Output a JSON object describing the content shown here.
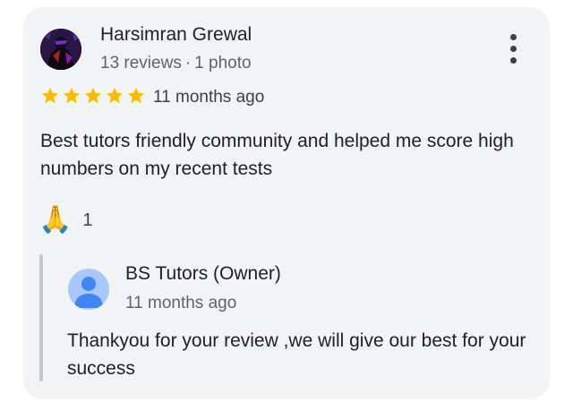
{
  "review": {
    "author_name": "Harsimran Grewal",
    "reviews_count": "13 reviews",
    "separator": "·",
    "photos_count": "1 photo",
    "rating": 5,
    "rating_max": 5,
    "time_ago": "11 months ago",
    "text": "Best tutors friendly community and helped me score high numbers on my recent tests",
    "reaction_emoji": "🙏",
    "reaction_count": "1"
  },
  "owner_reply": {
    "owner_name": "BS Tutors (Owner)",
    "time_ago": "11 months ago",
    "text": "Thankyou for your review ,we will give our best for your success"
  },
  "icons": {
    "menu": "more-vert-icon",
    "star": "star-icon",
    "owner_avatar": "person-icon"
  },
  "colors": {
    "star": "#fbbc04",
    "card_bg": "#f2f3f5",
    "owner_avatar_bg": "#a8c7fa",
    "owner_avatar_fg": "#4285f4"
  }
}
